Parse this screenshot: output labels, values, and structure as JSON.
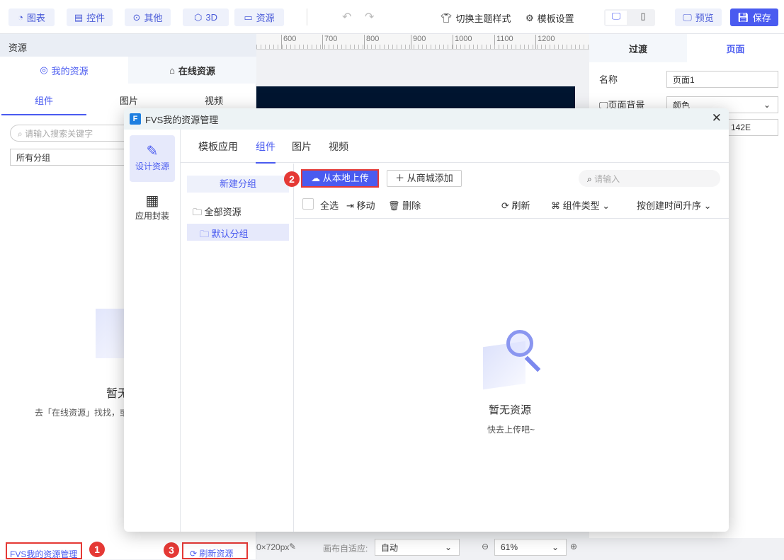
{
  "toolbar": {
    "chart": "图表",
    "control": "控件",
    "other": "其他",
    "three_d": "3D",
    "resource": "资源",
    "switch_theme": "切换主题样式",
    "template_settings": "模板设置",
    "preview": "预览",
    "save": "保存"
  },
  "ruler": [
    "600",
    "700",
    "800",
    "900",
    "1000",
    "1100",
    "1200"
  ],
  "left_panel": {
    "title": "资源",
    "tab_my": "我的资源",
    "tab_online": "在线资源",
    "subtabs": [
      "组件",
      "图片",
      "视频"
    ],
    "search_placeholder": "请输入搜索关键字",
    "group_select": "所有分组",
    "empty_title": "暂无资源",
    "empty_hint": "去「在线资源」找找，或",
    "manage_link": "FVS我的资源管理",
    "refresh": "刷新资源"
  },
  "right_panel": {
    "tab_transition": "过渡",
    "tab_page": "页面",
    "name_label": "名称",
    "name_value": "页面1",
    "bg_label": "页面背景",
    "bg_value": "颜色",
    "color_value": "142E"
  },
  "bottom": {
    "size": "0×720px",
    "adapt_label": "画布自适应:",
    "adapt_value": "自动",
    "zoom": "61%"
  },
  "modal": {
    "title": "FVS我的资源管理",
    "nav": [
      "设计资源",
      "应用封装"
    ],
    "tabs": [
      "模板应用",
      "组件",
      "图片",
      "视频"
    ],
    "new_group": "新建分组",
    "all_resources": "全部资源",
    "default_group": "默认分组",
    "upload": "从本地上传",
    "add_from_store": "从商城添加",
    "search_placeholder": "请输入",
    "select_all": "全选",
    "move": "移动",
    "delete": "删除",
    "refresh": "刷新",
    "component_type": "组件类型",
    "sort": "按创建时间升序",
    "empty_title": "暂无资源",
    "empty_hint": "快去上传吧~"
  },
  "badges": [
    "1",
    "2",
    "3"
  ],
  "colors": {
    "accent": "#4a5bf0",
    "marker": "#e53935"
  }
}
